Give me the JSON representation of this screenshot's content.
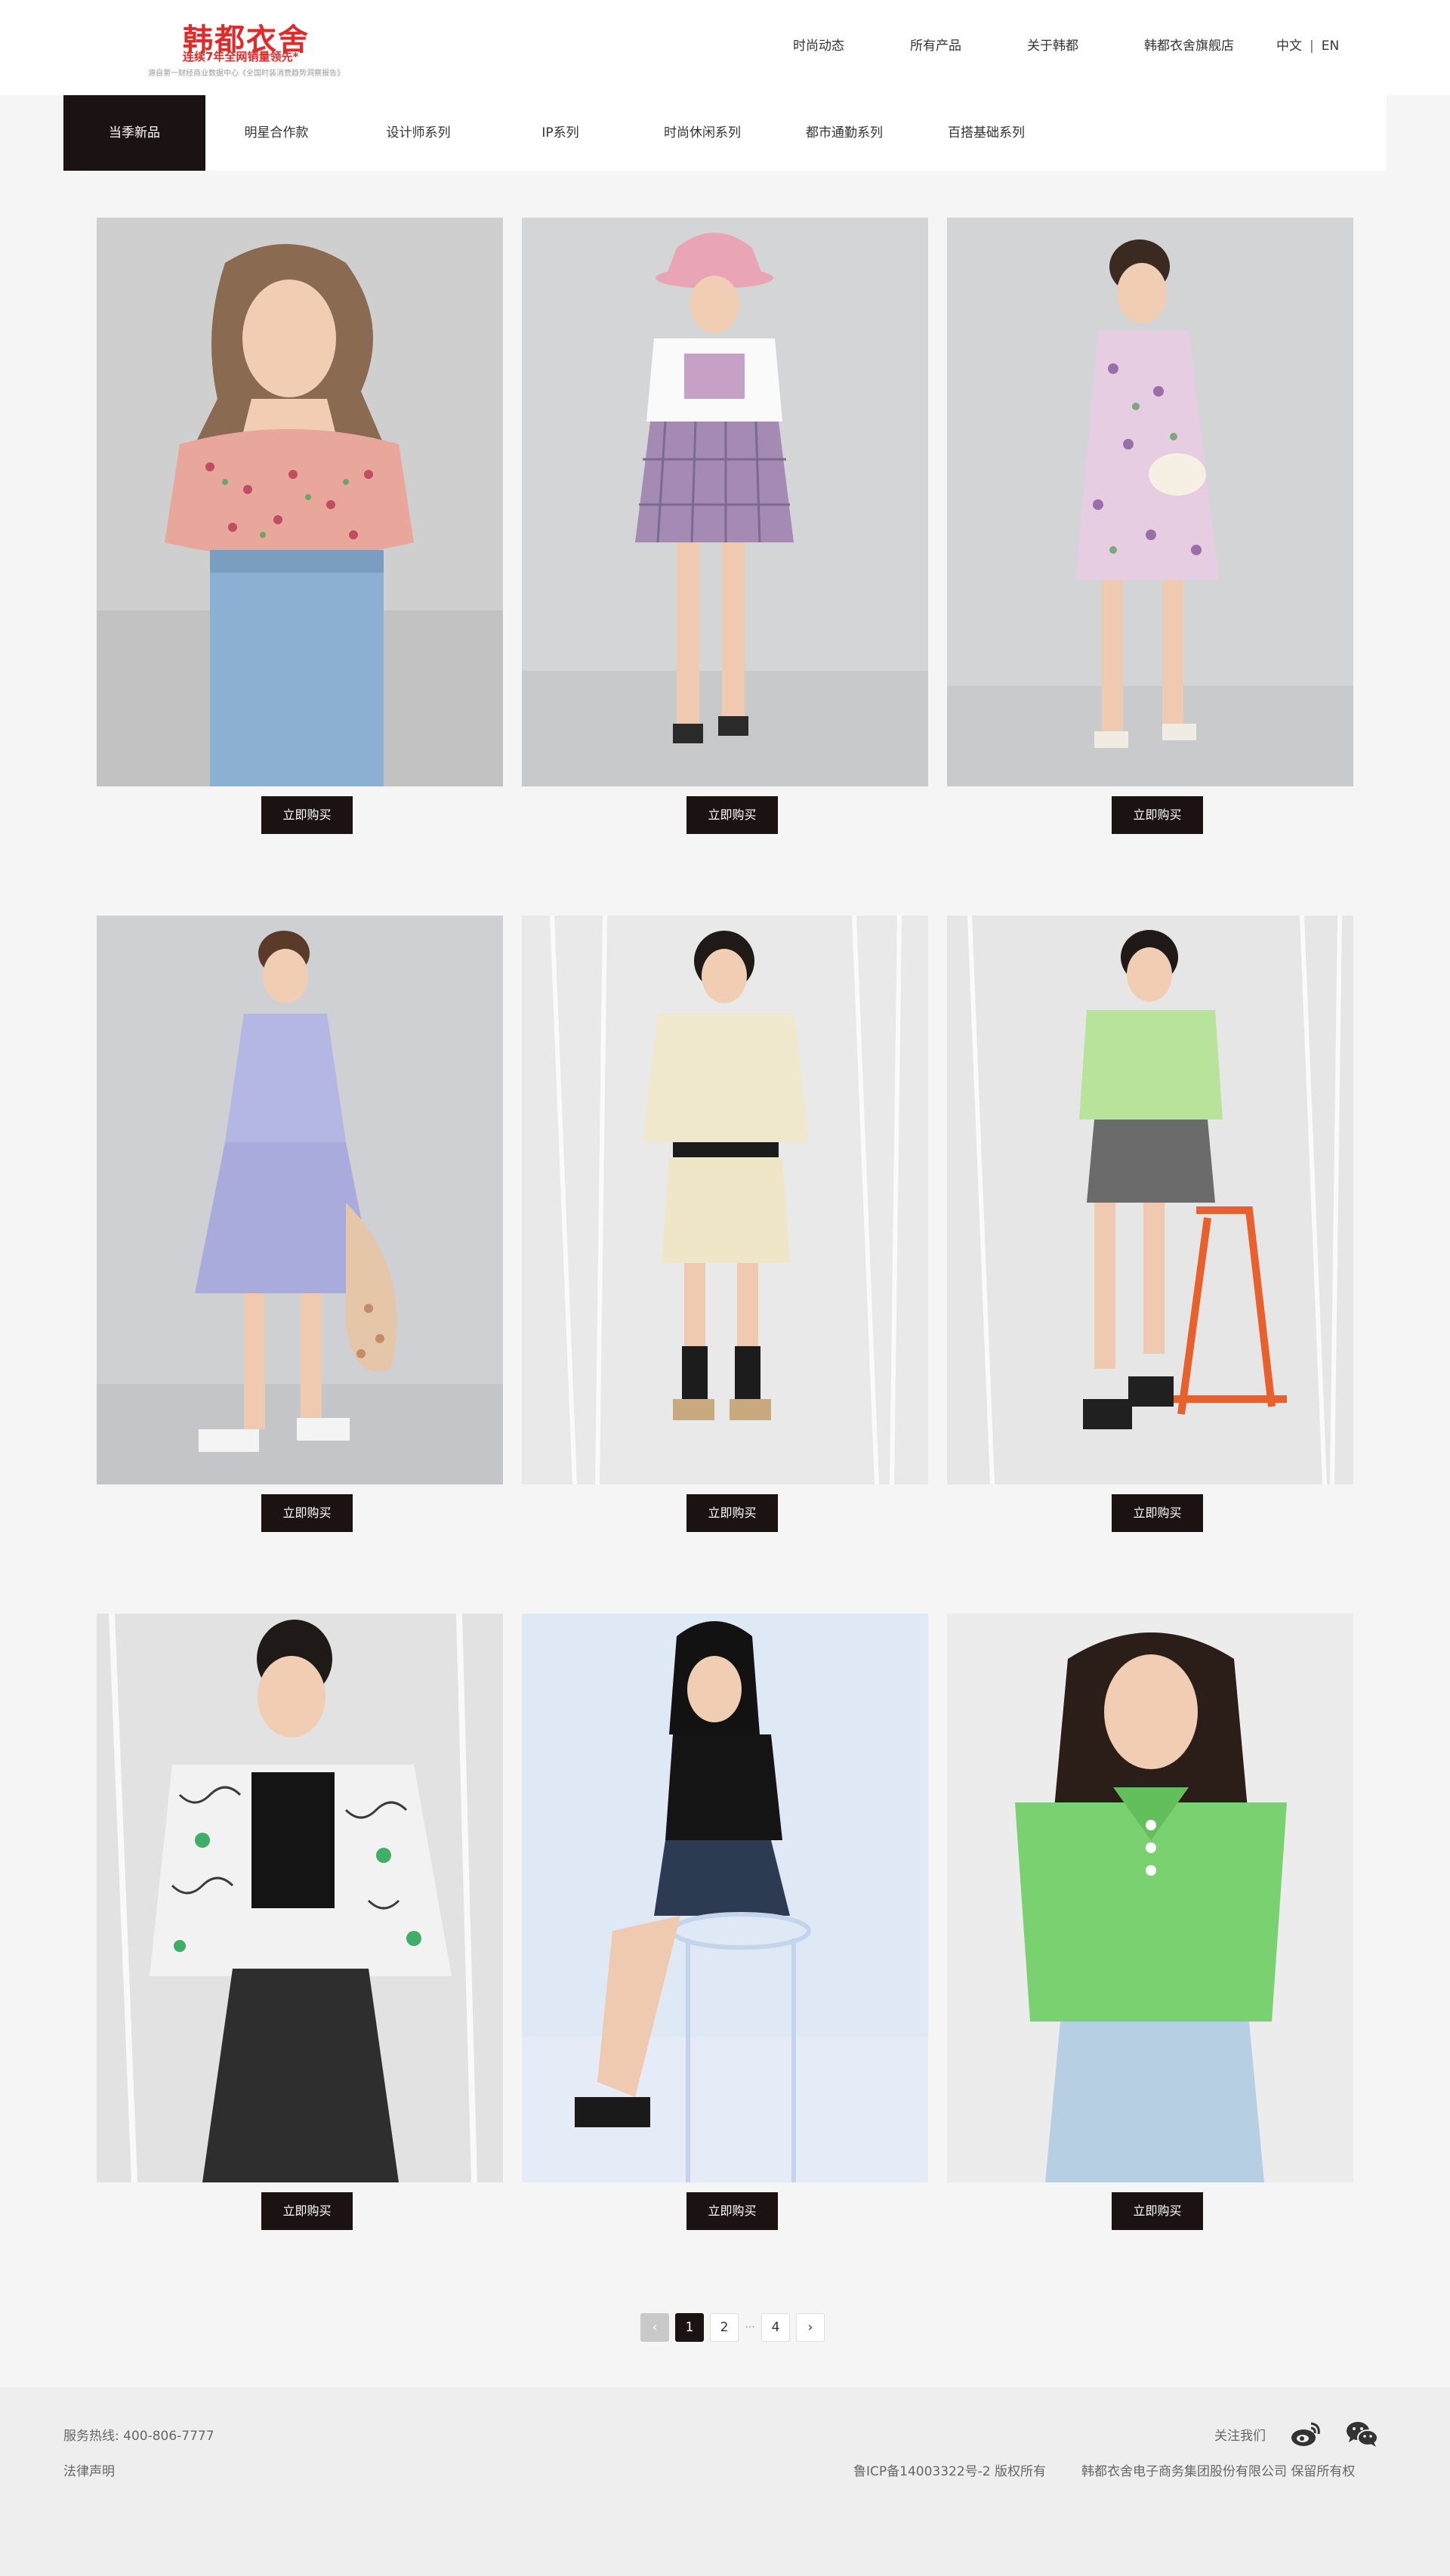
{
  "brand": {
    "logo_text": "韩都衣舍",
    "slogan": "连续7年全网销量领先*",
    "subline": "源自第一财经商业数据中心《全国时装消费趋势洞察报告》",
    "logo_color": "#e02b2b"
  },
  "top_nav": {
    "items": [
      "时尚动态",
      "所有产品",
      "关于韩都",
      "韩都衣舍旗舰店"
    ],
    "lang_cn": "中文",
    "lang_sep": "|",
    "lang_en": "EN"
  },
  "categories": {
    "active_index": 0,
    "items": [
      "当季新品",
      "明星合作款",
      "设计师系列",
      "IP系列",
      "时尚休闲系列",
      "都市通勤系列",
      "百搭基础系列"
    ]
  },
  "products": {
    "buy_label": "立即购买",
    "items": [
      {
        "photo": "model in pink floral ruched crop top and light denim jeans"
      },
      {
        "photo": "model in pink bucket hat, white graphic tee and purple plaid skirt"
      },
      {
        "photo": "model in pink floral dress with white shoulder bag"
      },
      {
        "photo": "model in lavender dress carrying floral bag"
      },
      {
        "photo": "model in cream short-sleeve jacket and matching shorts"
      },
      {
        "photo": "model in light green tee and grey denim shorts with orange chair"
      },
      {
        "photo": "model in white printed shirt over black top and black denim skirt"
      },
      {
        "photo": "model in black tee and denim shorts sitting on clear stool"
      },
      {
        "photo": "model in green polo shirt and light blue jeans"
      }
    ]
  },
  "pagination": {
    "prev": "‹",
    "pages": [
      "1",
      "2",
      "4"
    ],
    "ellipsis": "···",
    "next": "›",
    "current": "1"
  },
  "footer": {
    "hotline": "服务热线: 400-806-7777",
    "legal": "法律声明",
    "follow": "关注我们",
    "icp": "鲁ICP备14003322号-2 版权所有",
    "company": "韩都衣舍电子商务集团股份有限公司 保留所有权",
    "icons": [
      "weibo-icon",
      "wechat-icon"
    ]
  },
  "colors": {
    "accent_dark": "#1a1311",
    "page_bg": "#f5f5f5",
    "footer_bg": "#eeeeee"
  }
}
